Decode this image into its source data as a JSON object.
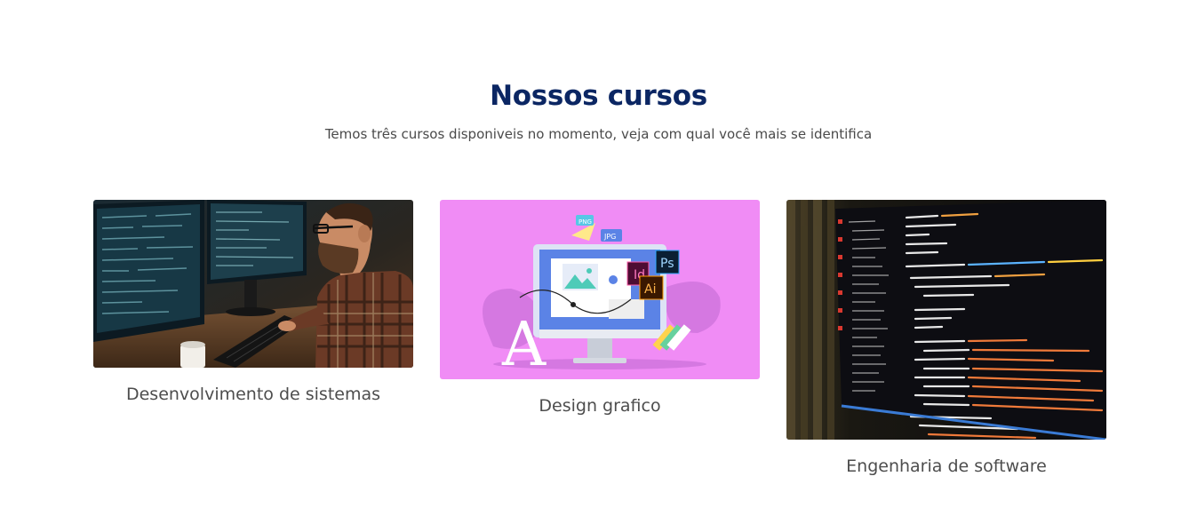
{
  "section": {
    "title": "Nossos cursos",
    "subtitle": "Temos três cursos disponiveis no momento, veja com qual você mais se identifica"
  },
  "courses": [
    {
      "label": "Desenvolvimento de sistemas",
      "image": "developer-at-monitors-photo"
    },
    {
      "label": "Design grafico",
      "image": "graphic-design-illustration"
    },
    {
      "label": "Engenharia de software",
      "image": "code-on-screen-photo"
    }
  ],
  "illustration": {
    "badges": [
      "Id",
      "Ps",
      "Ai"
    ],
    "file_tags": [
      "PNG",
      "JPG"
    ],
    "glyph": "A"
  },
  "colors": {
    "title": "#0b2663",
    "text": "#4d4d4d",
    "design_bg": "#f08cf5"
  }
}
